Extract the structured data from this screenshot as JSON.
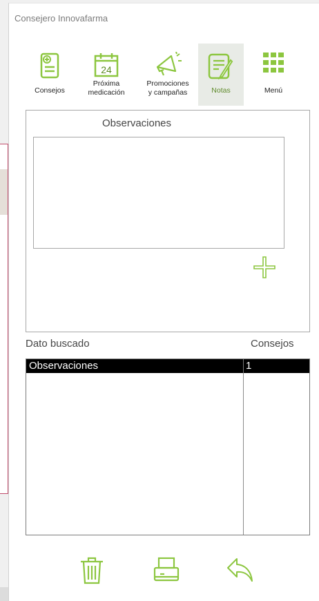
{
  "window": {
    "title": "Consejero Innovafarma"
  },
  "toolbar": {
    "items": [
      {
        "label": "Consejos",
        "icon": "clipboard-plus-icon"
      },
      {
        "label_line1": "Próxima",
        "label_line2": "medicación",
        "icon": "calendar-icon",
        "calendar_number": "24"
      },
      {
        "label_line1": "Promociones",
        "label_line2": "y campañas",
        "icon": "megaphone-icon"
      },
      {
        "label": "Notas",
        "icon": "notepad-pencil-icon",
        "active": true
      },
      {
        "label": "Menú",
        "icon": "grid-menu-icon"
      }
    ]
  },
  "observaciones": {
    "title": "Observaciones",
    "text_value": ""
  },
  "table": {
    "headers": [
      "Dato buscado",
      "Consejos"
    ],
    "rows": [
      {
        "dato": "Observaciones",
        "consejos": "1",
        "selected": true
      }
    ]
  },
  "actions": {
    "delete_icon": "trash-icon",
    "print_icon": "printer-icon",
    "back_icon": "undo-arrow-icon"
  },
  "colors": {
    "accent": "#8cc63f",
    "active_tab_bg": "#e8ebe6",
    "selected_row": "#000000"
  }
}
